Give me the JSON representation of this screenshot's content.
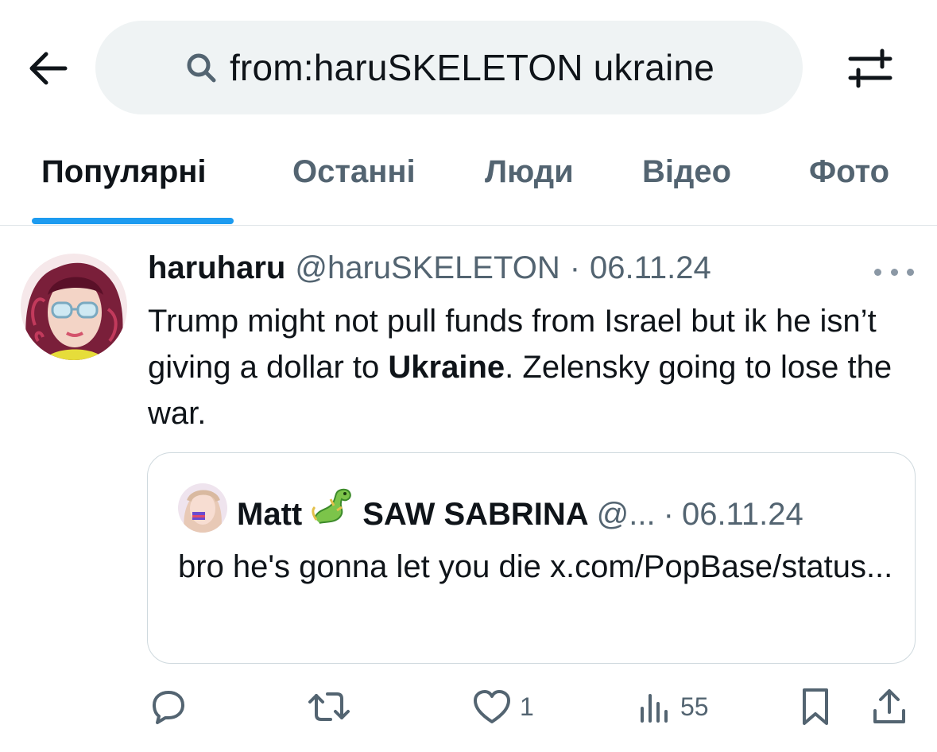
{
  "search": {
    "query": "from:haruSKELETON ukraine"
  },
  "tabs": [
    {
      "label": "Популярні",
      "active": true
    },
    {
      "label": "Останні",
      "active": false
    },
    {
      "label": "Люди",
      "active": false
    },
    {
      "label": "Відео",
      "active": false
    },
    {
      "label": "Фото",
      "active": false
    }
  ],
  "tweet": {
    "display_name": "haruharu",
    "handle": "@haruSKELETON",
    "separator": "·",
    "date": "06.11.24",
    "text_before": "Trump might not pull funds from Israel but ik he isn’t giving a dollar to ",
    "text_bold": "Ukraine",
    "text_after": ". Zelensky going to lose the war.",
    "quote": {
      "display_name_start": "Matt",
      "emoji": "dragon-emoji",
      "display_name_end": "SAW SABRINA",
      "handle": "@...",
      "separator": "·",
      "date": "06.11.24",
      "text": "bro he's gonna let you die x.com/PopBase/status..."
    },
    "actions": {
      "replies": "",
      "reposts": "",
      "likes": "1",
      "views": "55"
    }
  },
  "colors": {
    "accent": "#1d9bf0",
    "text_primary": "#0f1419",
    "text_secondary": "#536471",
    "search_bg": "#eff3f4",
    "border": "#cfd9de"
  },
  "icons": {
    "back": "arrow-left-icon",
    "search": "magnifier-icon",
    "filter": "sliders-icon",
    "more": "more-dots-icon",
    "reply": "reply-icon",
    "repost": "repost-icon",
    "like": "heart-icon",
    "views": "views-chart-icon",
    "bookmark": "bookmark-icon",
    "share": "share-icon"
  }
}
